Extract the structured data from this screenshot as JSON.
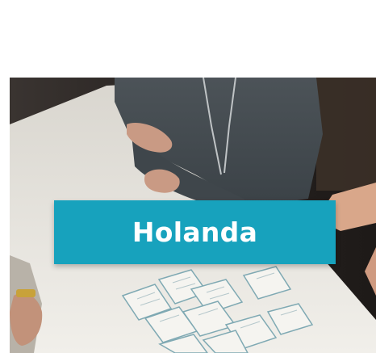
{
  "card": {
    "title": "Holanda",
    "image_alt": "photo-of-people-playing-card-game-at-table"
  },
  "colors": {
    "banner_background": "#17a2bd",
    "banner_text": "#ffffff",
    "page_background": "#ffffff"
  }
}
